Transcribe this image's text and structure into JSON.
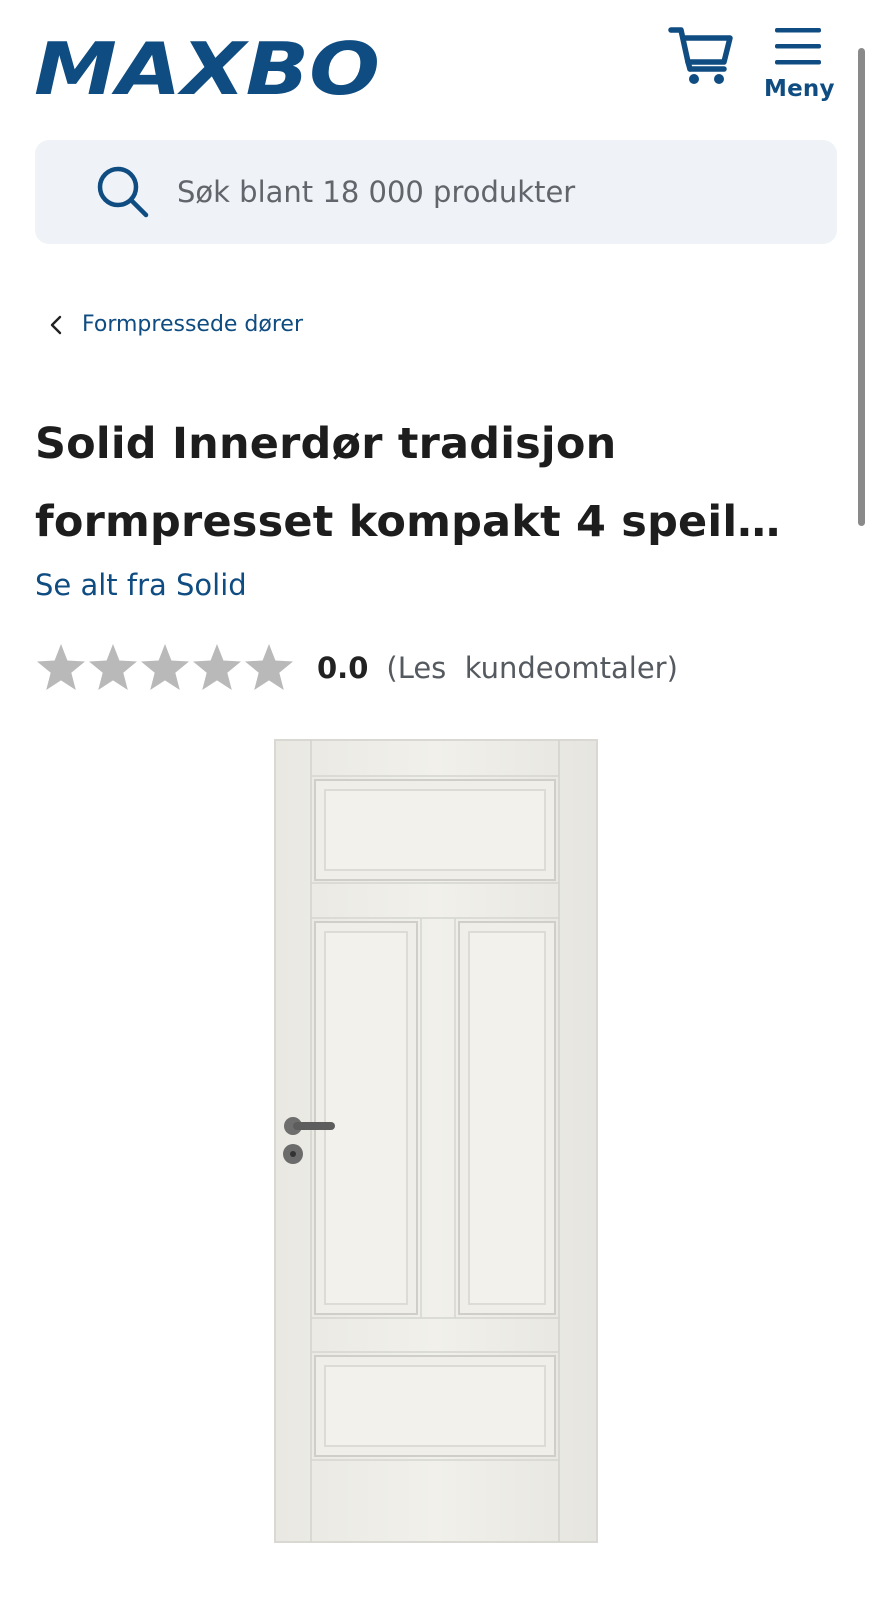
{
  "header": {
    "logo_text": "MAXBO",
    "cart_icon": "cart-icon",
    "menu_icon": "hamburger-icon",
    "menu_label": "Meny",
    "brand_color": "#0f4c81"
  },
  "search": {
    "icon": "search-icon",
    "placeholder": "Søk blant 18 000 produkter"
  },
  "breadcrumb": {
    "icon": "chevron-left-icon",
    "label": "Formpressede dører"
  },
  "product": {
    "title": "Solid Innerdør tradisjon formpresset kompakt 4 speil…",
    "brand_link": "Se alt fra Solid",
    "rating": {
      "stars": 5,
      "filled": 0,
      "value": "0.0",
      "reviews_link": "(Les  kundeomtaler)",
      "star_color": "#b9b9b9"
    },
    "image": "white-four-panel-door"
  }
}
